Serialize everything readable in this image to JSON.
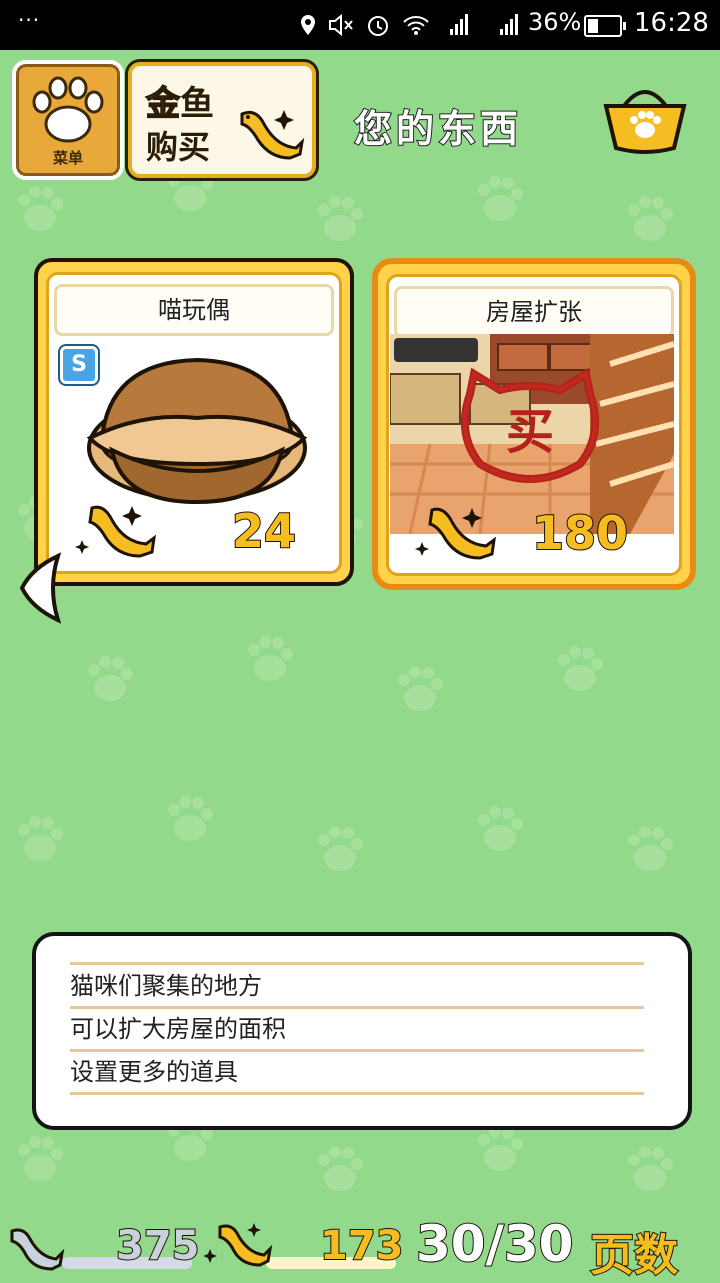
{
  "status_bar": {
    "dots": "···",
    "battery": "36%",
    "time": "16:28"
  },
  "top": {
    "menu_label": "菜单",
    "gold_buy_line1": "金鱼",
    "gold_buy_gold_char": "金",
    "gold_buy_rest_char": "鱼",
    "gold_buy_line2": "购买",
    "heading": "您的东西"
  },
  "items": [
    {
      "name": "喵玩偶",
      "price": "24",
      "badge": "S",
      "selected": false
    },
    {
      "name": "房屋扩张",
      "price": "180",
      "stamp": "买",
      "selected": true
    }
  ],
  "description": {
    "lines": [
      "猫咪们聚集的地方",
      "可以扩大房屋的面积",
      "设置更多的道具"
    ]
  },
  "footer": {
    "silver_fish": "375",
    "gold_fish": "173",
    "page": "30/30",
    "page_label": "页数"
  },
  "colors": {
    "background": "#93d98b",
    "gold": "#f5bd21",
    "selected_border": "#e88b14"
  }
}
